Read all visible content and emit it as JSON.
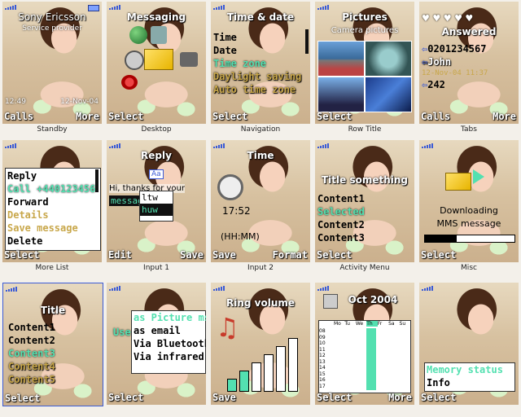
{
  "colors": {
    "highlight": "#53e0b0",
    "signal": "#3b5bd6",
    "title": "#ffffff"
  },
  "cells": [
    {
      "caption": "Standby",
      "brand": "Sony Ericsson",
      "operator": "Service provider",
      "time": "12:49",
      "date": "12-Nov-04",
      "left": "Calls",
      "right": "More"
    },
    {
      "caption": "Desktop",
      "title": "Messaging",
      "left": "Select",
      "icons": [
        "globe-icon",
        "envelope-icon",
        "phone-icon",
        "clock-icon",
        "camera-icon",
        "settings-icon"
      ]
    },
    {
      "caption": "Navigation",
      "title": "Time & date",
      "items": [
        "Time",
        "Date",
        "Time zone",
        "Daylight saving",
        "Auto time zone"
      ],
      "left": "Select"
    },
    {
      "caption": "Row Title",
      "title": "Pictures",
      "subtitle": "Camera pictures",
      "left": "Select"
    },
    {
      "caption": "Tabs",
      "title": "Answered",
      "numbers": [
        "0201234567",
        "John",
        "242"
      ],
      "datestamp": "12-Nov-04 11:37",
      "left": "Calls",
      "right": "More"
    },
    {
      "caption": "More List",
      "items": [
        "Reply",
        "Call +440123456",
        "Forward",
        "Details",
        "Save message",
        "Delete"
      ],
      "left": "Select"
    },
    {
      "caption": "Input 1",
      "title": "Reply",
      "mode": "Aa",
      "message": "Hi, thanks for your",
      "word": "message",
      "options": [
        "ltw",
        "huw"
      ],
      "left": "Edit",
      "right": "Save"
    },
    {
      "caption": "Input 2",
      "title": "Time",
      "clock": "17:52",
      "format": "(HH:MM)",
      "left": "Save",
      "right": "Format"
    },
    {
      "caption": "Activity Menu",
      "title": "Title something",
      "items": [
        "Content1",
        "Selected",
        "Content2",
        "Content3"
      ],
      "left": "Select"
    },
    {
      "caption": "Misc",
      "status": "Downloading",
      "status2": "MMS message",
      "progress": 0.35,
      "left": "Select"
    },
    {
      "caption": "",
      "title": "Title",
      "items": [
        "Content1",
        "Content2",
        "Content3",
        "Content4",
        "Content5"
      ],
      "left": "Select"
    },
    {
      "caption": "",
      "label": "Use",
      "items": [
        "as Picture msg",
        "as email",
        "Via Bluetooth",
        "Via infrared"
      ],
      "left": "Select"
    },
    {
      "caption": "",
      "title": "Ring volume",
      "left": "Save"
    },
    {
      "caption": "",
      "title": "Oct 2004",
      "days": [
        "Mo",
        "Tu",
        "We",
        "Th",
        "Fr",
        "Sa",
        "Su"
      ],
      "hours": [
        "08",
        "09",
        "10",
        "11",
        "12",
        "13",
        "14",
        "15",
        "16",
        "17"
      ],
      "left": "Select",
      "right": "More"
    },
    {
      "caption": "",
      "items": [
        "Memory status",
        "Info"
      ],
      "left": "Select"
    }
  ]
}
